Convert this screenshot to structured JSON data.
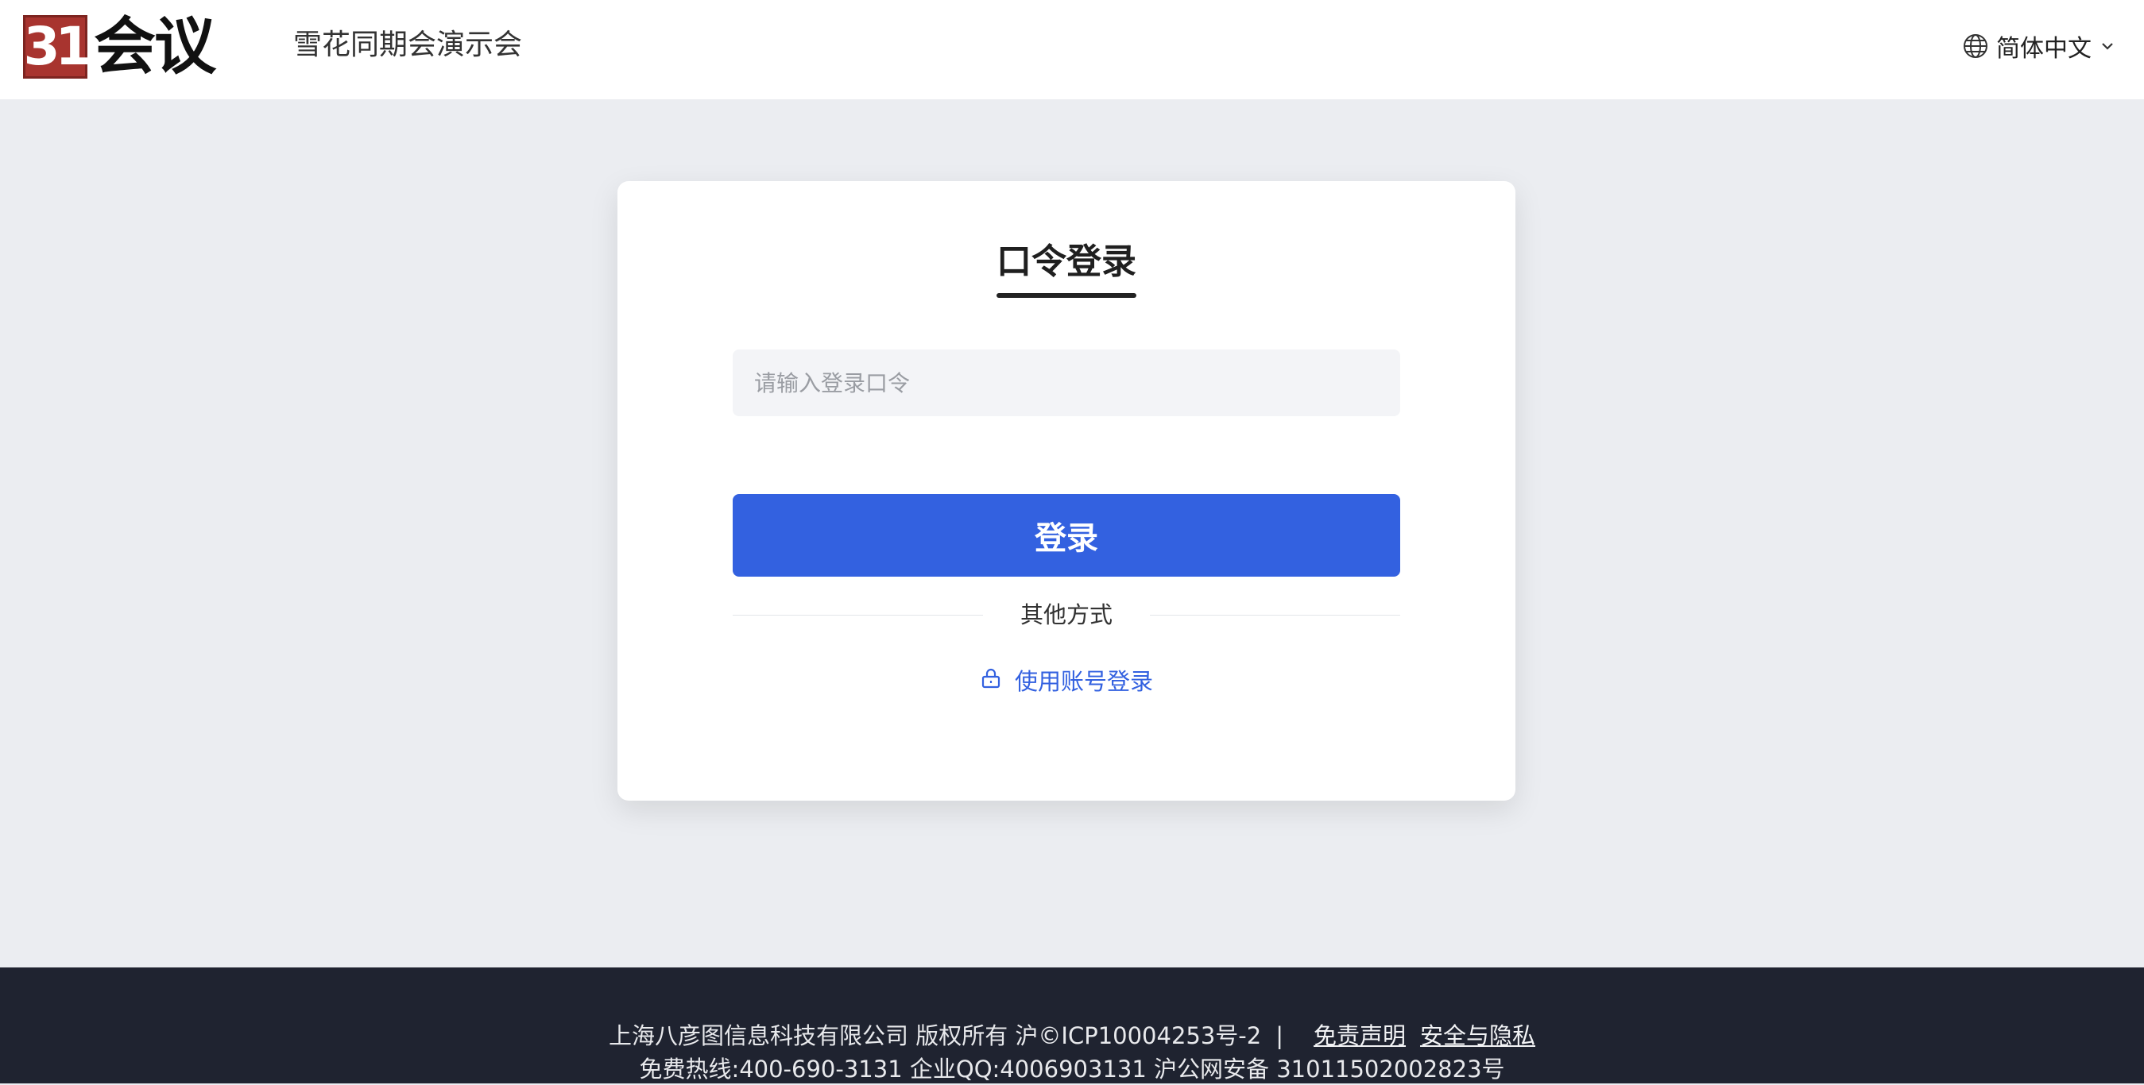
{
  "header": {
    "logo_number": "31",
    "logo_text": "会议",
    "event_title": "雪花同期会演示会",
    "language": "简体中文",
    "globe_icon": "globe-icon",
    "chevron_icon": "chevron-down-icon"
  },
  "login": {
    "title": "口令登录",
    "input_placeholder": "请输入登录口令",
    "input_value": "",
    "submit_label": "登录",
    "divider_text": "其他方式",
    "alt_login_label": "使用账号登录",
    "alt_login_icon": "lock-icon"
  },
  "colors": {
    "primary": "#3361e0",
    "page_bg": "#ebedf1",
    "footer_bg": "#1f2330",
    "logo_red": "#a8342f"
  },
  "footer": {
    "copyright": "上海八彦图信息科技有限公司 版权所有 沪©ICP10004253号-2",
    "separator": "|",
    "disclaimer_link": "免责声明",
    "privacy_link": "安全与隐私",
    "contact": "免费热线:400-690-3131 企业QQ:4006903131 沪公网安备 31011502002823号"
  }
}
